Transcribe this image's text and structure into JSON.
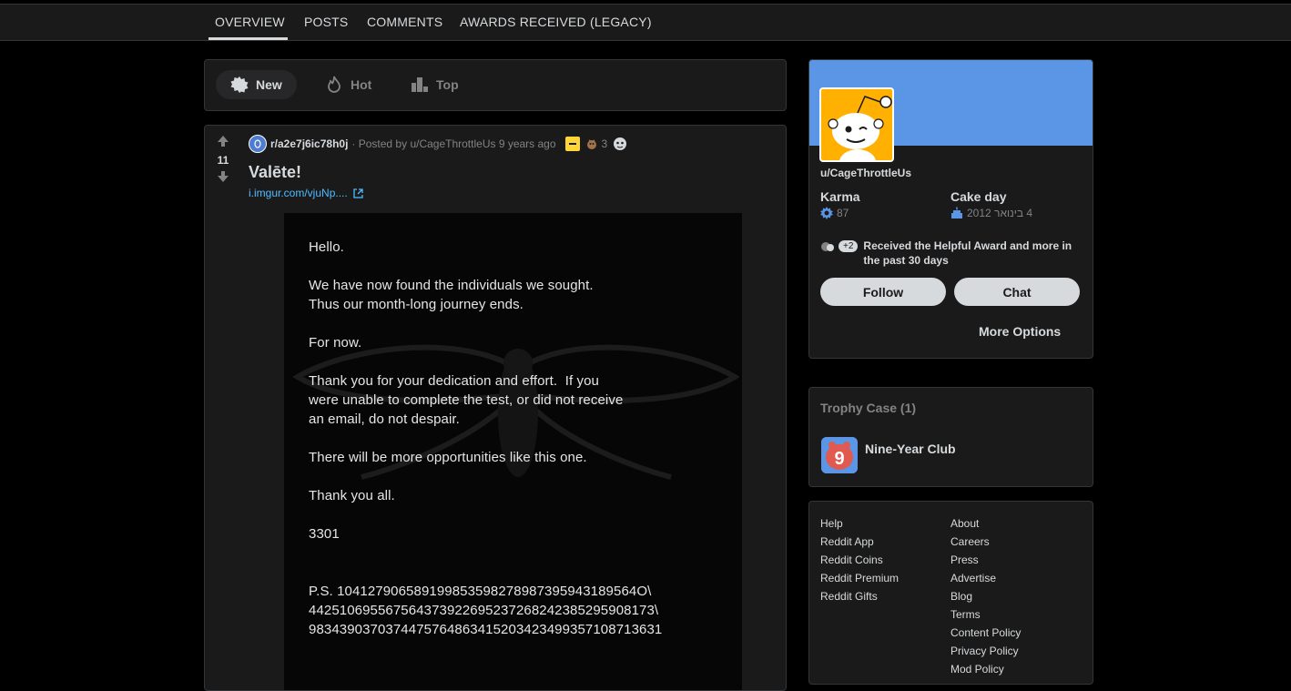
{
  "tabs": [
    "OVERVIEW",
    "POSTS",
    "COMMENTS",
    "AWARDS RECEIVED (LEGACY)"
  ],
  "sort": {
    "new": "New",
    "hot": "Hot",
    "top": "Top"
  },
  "post": {
    "score": "11",
    "subreddit": "r/a2e7j6ic78h0j",
    "posted_by": "· Posted by u/CageThrottleUs 9 years ago",
    "award_count": "3",
    "title": "Valēte!",
    "link_text": "i.imgur.com/vjuNp....",
    "image_text": "Hello.\n\nWe have now found the individuals we sought.\nThus our month-long journey ends.\n\nFor now.\n\nThank you for your dedication and effort.  If you\nwere unable to complete the test, or did not receive\nan email, do not despair.\n\nThere will be more opportunities like this one.\n\nThank you all.\n\n3301\n\n\nP.S. 104127906589199853598278987395943189564O\\\n442510695567564373922695237268242385295908173\\\n983439037037447576486341520342349935710871363​1"
  },
  "profile": {
    "username": "u/CageThrottleUs",
    "karma_label": "Karma",
    "karma_value": "87",
    "cake_label": "Cake day",
    "cake_value": "4 בינואר 2012",
    "awards_more": "+2",
    "awards_text": "Received the Helpful Award and more in the past 30 days",
    "follow": "Follow",
    "chat": "Chat",
    "more_options": "More Options"
  },
  "trophy": {
    "title": "Trophy Case (1)",
    "name": "Nine-Year Club"
  },
  "footer": {
    "left": [
      "Help",
      "Reddit App",
      "Reddit Coins",
      "Reddit Premium",
      "Reddit Gifts"
    ],
    "right": [
      "About",
      "Careers",
      "Press",
      "Advertise",
      "Blog",
      "Terms",
      "Content Policy",
      "Privacy Policy",
      "Mod Policy"
    ]
  },
  "colors": {
    "accent_link": "#4fbcff",
    "banner": "#5b96e6",
    "avatar_bg": "#ffb000",
    "archive": "#ffd635"
  }
}
